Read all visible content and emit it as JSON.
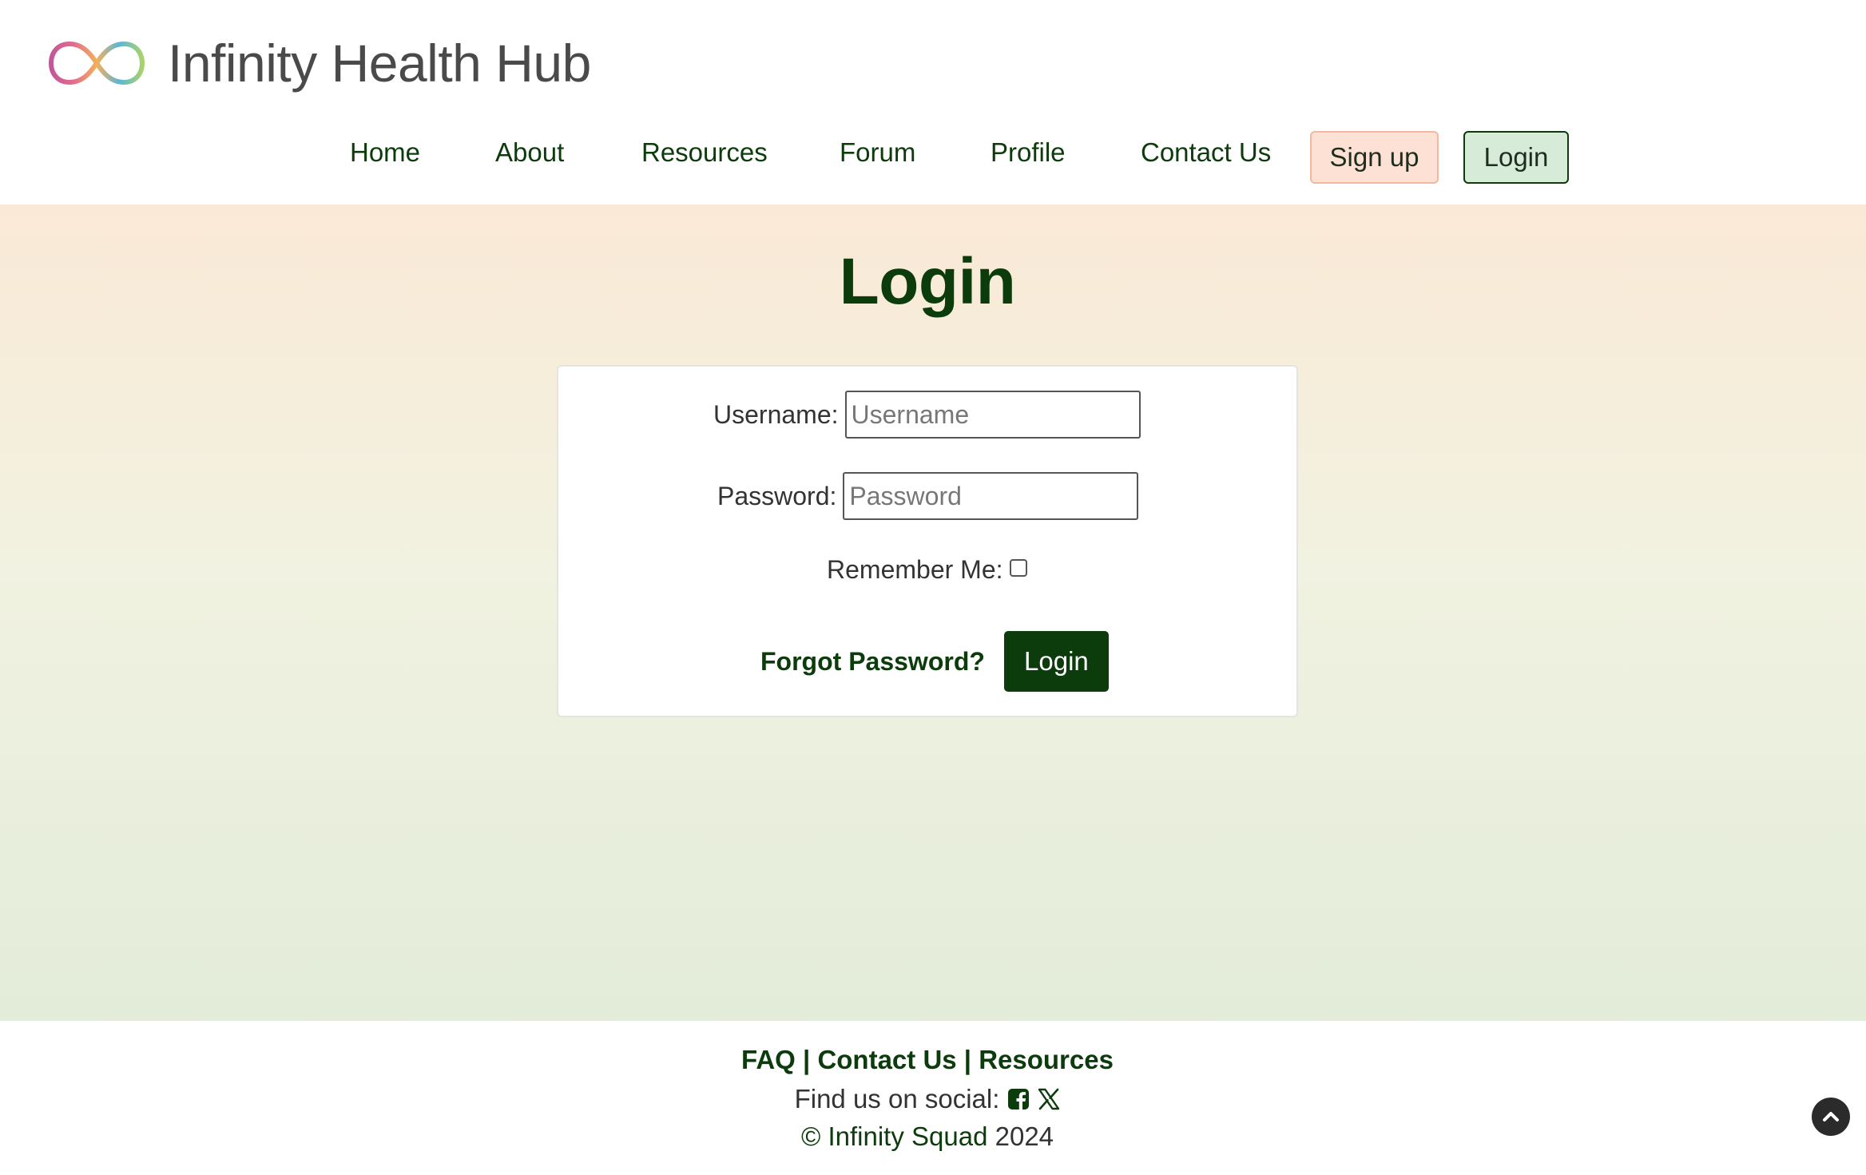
{
  "header": {
    "site_title": "Infinity Health Hub",
    "logo_icon": "infinity-logo-icon"
  },
  "nav": {
    "items": [
      {
        "label": "Home"
      },
      {
        "label": "About"
      },
      {
        "label": "Resources"
      },
      {
        "label": "Forum"
      },
      {
        "label": "Profile"
      },
      {
        "label": "Contact Us"
      }
    ],
    "signup_label": "Sign up",
    "login_label": "Login"
  },
  "login_form": {
    "title": "Login",
    "username_label": "Username:",
    "username_placeholder": "Username",
    "username_value": "",
    "password_label": "Password:",
    "password_placeholder": "Password",
    "password_value": "",
    "remember_label": "Remember Me:",
    "remember_checked": false,
    "forgot_label": "Forgot Password?",
    "submit_label": "Login"
  },
  "footer": {
    "links": [
      {
        "label": "FAQ"
      },
      {
        "label": "Contact Us"
      },
      {
        "label": "Resources"
      }
    ],
    "separator": "|",
    "social_label": "Find us on social:",
    "social_icons": [
      "facebook-icon",
      "x-icon"
    ],
    "copyright_symbol": "©",
    "copyright_name": "Infinity Squad",
    "copyright_year": "2024",
    "scroll_top_icon": "chevron-up-icon"
  },
  "colors": {
    "brand_green": "#0c3b0c",
    "signup_bg": "#fce1d4",
    "login_bg": "#d6ecd9",
    "gradient_top": "#fae9d6",
    "gradient_bottom": "#e3ecd9"
  }
}
